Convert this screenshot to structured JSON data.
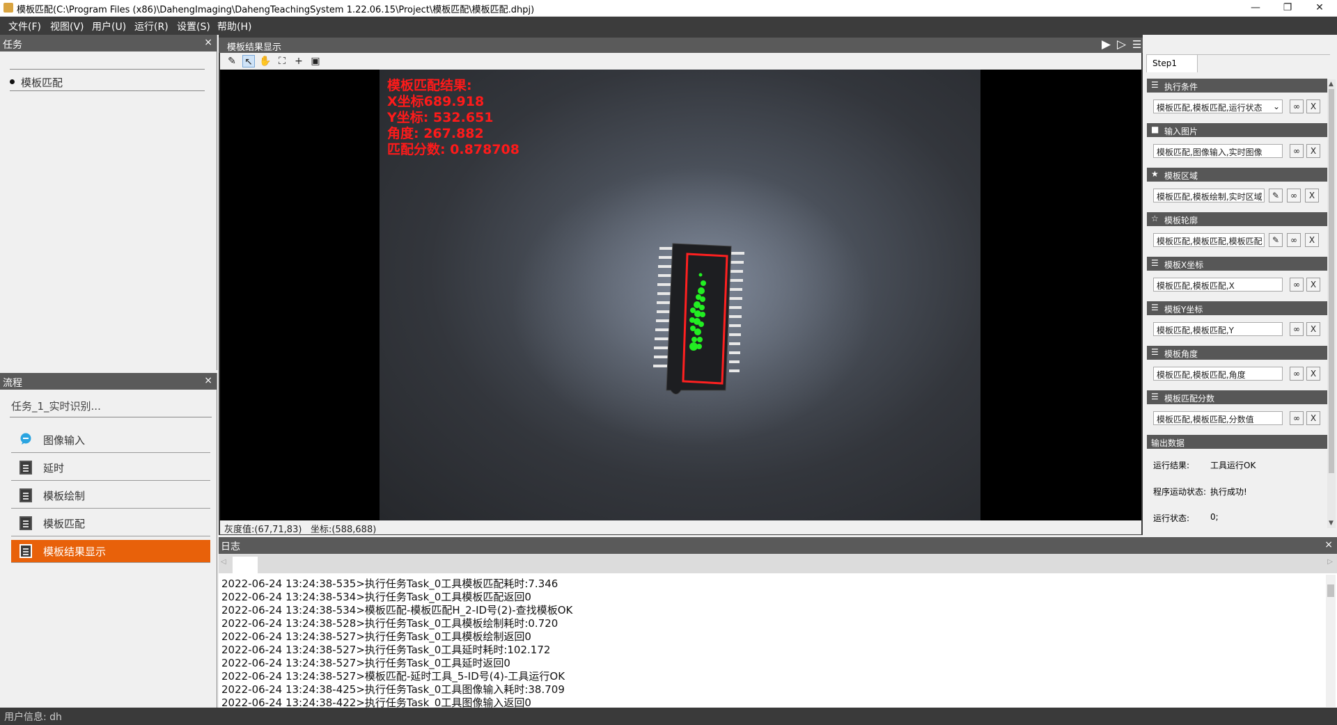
{
  "window": {
    "title": "模板匹配(C:\\Program Files (x86)\\DahengImaging\\DahengTeachingSystem 1.22.06.15\\Project\\模板匹配\\模板匹配.dhpj)",
    "minimize": "—",
    "restore": "❐",
    "close": "✕"
  },
  "menu": [
    "文件(F)",
    "视图(V)",
    "用户(U)",
    "运行(R)",
    "设置(S)",
    "帮助(H)"
  ],
  "task_panel": {
    "title": "任务",
    "close": "×",
    "items": [
      "模板匹配"
    ]
  },
  "flow_panel": {
    "title": "流程",
    "close": "×",
    "task_name": "任务_1_实时识别...",
    "items": [
      {
        "label": "图像输入",
        "icon": "chat-bubble-icon",
        "active": false
      },
      {
        "label": "延时",
        "icon": "document-icon",
        "active": false
      },
      {
        "label": "模板绘制",
        "icon": "document-icon",
        "active": false
      },
      {
        "label": "模板匹配",
        "icon": "document-icon",
        "active": false
      },
      {
        "label": "模板结果显示",
        "icon": "document-icon",
        "active": true
      }
    ]
  },
  "display": {
    "title": "模板结果显示",
    "overlay": [
      "模板匹配结果:",
      "X坐标689.918",
      "Y坐标: 532.651",
      "角度: 267.882",
      "匹配分数: 0.878708"
    ],
    "status_gray": "灰度值:(67,71,83)",
    "status_coord": "坐标:(588,688)",
    "colors": {
      "overlay_text": "#ff1a1a",
      "roi_box": "#ff2020",
      "match": "#22ee22"
    }
  },
  "right_panel": {
    "tab": "Step1",
    "sections": [
      {
        "title": "执行条件",
        "icon": "☰",
        "value": "模板匹配,模板匹配,运行状态",
        "dropdown": true,
        "edit": false
      },
      {
        "title": "输入图片",
        "icon": "■",
        "value": "模板匹配,图像输入,实时图像",
        "dropdown": false,
        "edit": false
      },
      {
        "title": "模板区域",
        "icon": "★",
        "value": "模板匹配,模板绘制,实时区域",
        "dropdown": false,
        "edit": true
      },
      {
        "title": "模板轮廓",
        "icon": "☆",
        "value": "模板匹配,模板匹配,模板匹配",
        "dropdown": false,
        "edit": true
      },
      {
        "title": "模板X坐标",
        "icon": "☰",
        "value": "模板匹配,模板匹配,X",
        "dropdown": false,
        "edit": false
      },
      {
        "title": "模板Y坐标",
        "icon": "☰",
        "value": "模板匹配,模板匹配,Y",
        "dropdown": false,
        "edit": false
      },
      {
        "title": "模板角度",
        "icon": "☰",
        "value": "模板匹配,模板匹配,角度",
        "dropdown": false,
        "edit": false
      },
      {
        "title": "模板匹配分数",
        "icon": "☰",
        "value": "模板匹配,模板匹配,分数值",
        "dropdown": false,
        "edit": false
      }
    ],
    "link_btn": "∞",
    "x_btn": "X",
    "edit_btn": "✎",
    "output": {
      "title": "输出数据",
      "rows": [
        {
          "label": "运行结果:",
          "value": "工具运行OK"
        },
        {
          "label": "程序运动状态:",
          "value": "执行成功!"
        },
        {
          "label": "运行状态:",
          "value": "0;"
        }
      ]
    }
  },
  "log": {
    "title": "日志",
    "close": "×",
    "lines": [
      "2022-06-24 13:24:38-535>执行任务Task_0工具模板匹配耗时:7.346",
      "2022-06-24 13:24:38-534>执行任务Task_0工具模板匹配返回0",
      "2022-06-24 13:24:38-534>模板匹配-模板匹配H_2-ID号(2)-查找模板OK",
      "2022-06-24 13:24:38-528>执行任务Task_0工具模板绘制耗时:0.720",
      "2022-06-24 13:24:38-527>执行任务Task_0工具模板绘制返回0",
      "2022-06-24 13:24:38-527>执行任务Task_0工具延时耗时:102.172",
      "2022-06-24 13:24:38-527>执行任务Task_0工具延时返回0",
      "2022-06-24 13:24:38-527>模板匹配-延时工具_5-ID号(4)-工具运行OK",
      "2022-06-24 13:24:38-425>执行任务Task_0工具图像输入耗时:38.709",
      "2022-06-24 13:24:38-422>执行任务Task_0工具图像输入返回0"
    ]
  },
  "footer": {
    "user_info": "用户信息: dh"
  }
}
